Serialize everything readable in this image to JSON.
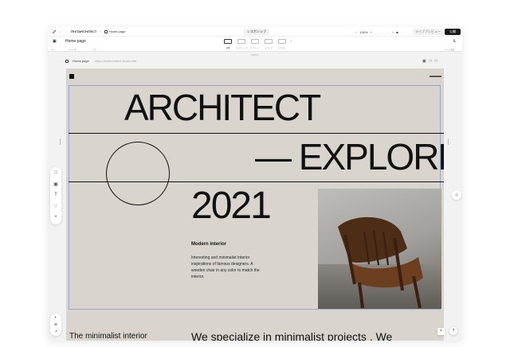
{
  "topbar": {
    "project": "TESTARCHITECT",
    "page": "Home page",
    "responsive": "レスポンシブ",
    "zoom_minus": "−",
    "zoom": "100%",
    "zoom_plus": "+",
    "undo": "←",
    "redo": "→",
    "add": "+",
    "live_preview": "ライブプレビュー",
    "publish": "公開"
  },
  "toolbar": {
    "page_name": "Home page",
    "labels": [
      "モバ",
      "ページ名",
      "コピ"
    ],
    "devices": [
      "全体",
      "デスクトップ",
      "タブレット",
      "モバイル",
      "カスタム"
    ],
    "page_settings": "ページ設定"
  },
  "ruler": "1920px",
  "page_tab": {
    "label": "Home page",
    "url": "https://testarchitect.studio.site"
  },
  "site": {
    "title": "ARCHITECT",
    "subtitle": "— EXPLORE",
    "year": "2021",
    "section_title": "Modern interior",
    "section_body": "Interesting and minimalist interior inspirations of famous designers. A wooden chair in any color to match the interior.",
    "below_left": "The minimalist interior",
    "below_right": "We specialize in minimalist projects . We"
  },
  "left_tools": [
    "□",
    "▣",
    "T",
    "♡",
    "+"
  ],
  "left_tools2": [
    "◐",
    "⊕",
    "↗"
  ],
  "help": "?",
  "colors": {
    "canvas_bg": "#d9d5ce",
    "publish": "#1a1a1a",
    "selection": "#99a7c8"
  }
}
